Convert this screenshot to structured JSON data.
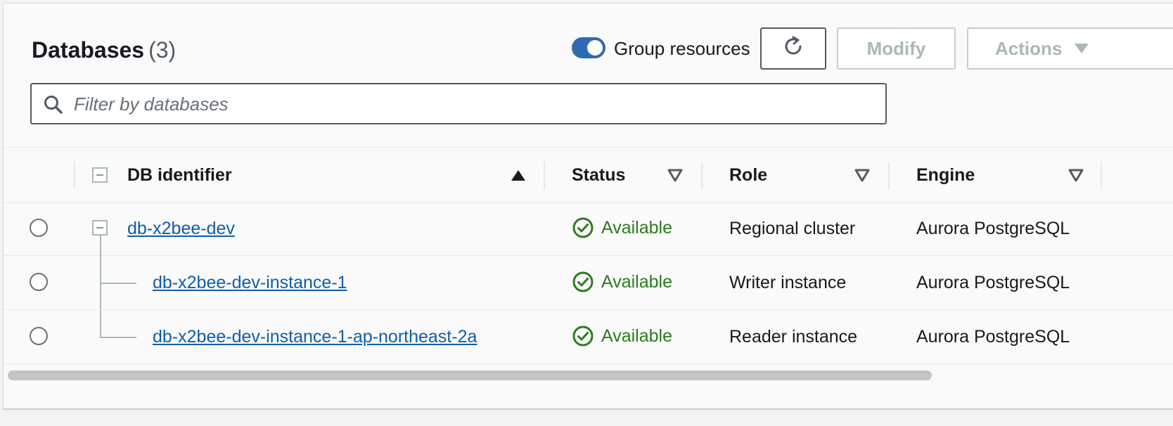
{
  "header": {
    "title": "Databases",
    "count": "(3)",
    "group_toggle_label": "Group resources",
    "group_toggle_on": true,
    "buttons": {
      "refresh_icon": "refresh-icon",
      "modify": "Modify",
      "actions": "Actions"
    }
  },
  "search": {
    "placeholder": "Filter by databases",
    "value": ""
  },
  "table": {
    "columns": [
      "DB identifier",
      "Status",
      "Role",
      "Engine"
    ],
    "sort": {
      "column": "DB identifier",
      "direction": "ascending"
    },
    "rows": [
      {
        "identifier": "db-x2bee-dev",
        "status": "Available",
        "role": "Regional cluster",
        "engine": "Aurora PostgreSQL"
      },
      {
        "identifier": "db-x2bee-dev-instance-1",
        "status": "Available",
        "role": "Writer instance",
        "engine": "Aurora PostgreSQL"
      },
      {
        "identifier": "db-x2bee-dev-instance-1-ap-northeast-2a",
        "status": "Available",
        "role": "Reader instance",
        "engine": "Aurora PostgreSQL"
      }
    ]
  },
  "colors": {
    "accent": "#2f6bb2",
    "link": "#0f5ea8",
    "status_available": "#2d7b1f",
    "disabled_text": "#aab7b8"
  }
}
